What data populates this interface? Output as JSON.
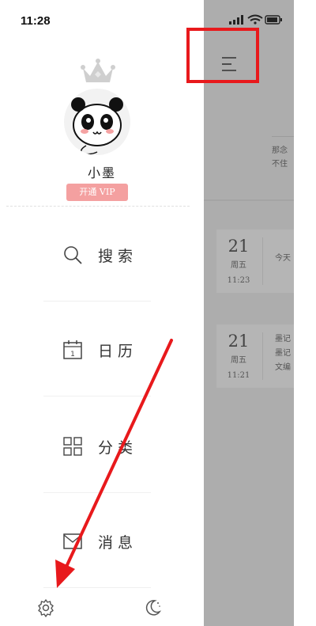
{
  "status_bar": {
    "time": "11:28"
  },
  "drawer": {
    "username": "小墨",
    "vip_label": "开通 VIP",
    "menu": [
      {
        "id": "search",
        "label": "搜索",
        "icon": "search-icon"
      },
      {
        "id": "calendar",
        "label": "日历",
        "icon": "calendar-icon",
        "icon_text": "1"
      },
      {
        "id": "category",
        "label": "分类",
        "icon": "grid-icon"
      },
      {
        "id": "messages",
        "label": "消息",
        "icon": "mail-icon"
      }
    ],
    "bottom": {
      "left_icon": "settings-icon",
      "right_icon": "moon-icon"
    }
  },
  "main": {
    "note_partial": [
      "那念",
      "不住"
    ],
    "cards": [
      {
        "day": "21",
        "weekday": "周五",
        "time": "11:23",
        "lines": [
          "今天"
        ]
      },
      {
        "day": "21",
        "weekday": "周五",
        "time": "11:21",
        "lines": [
          "墨记",
          "墨记",
          "文编"
        ]
      }
    ]
  },
  "colors": {
    "highlight": "#e8191c",
    "vip": "#f4a0a0",
    "overlay": "#adadad"
  }
}
